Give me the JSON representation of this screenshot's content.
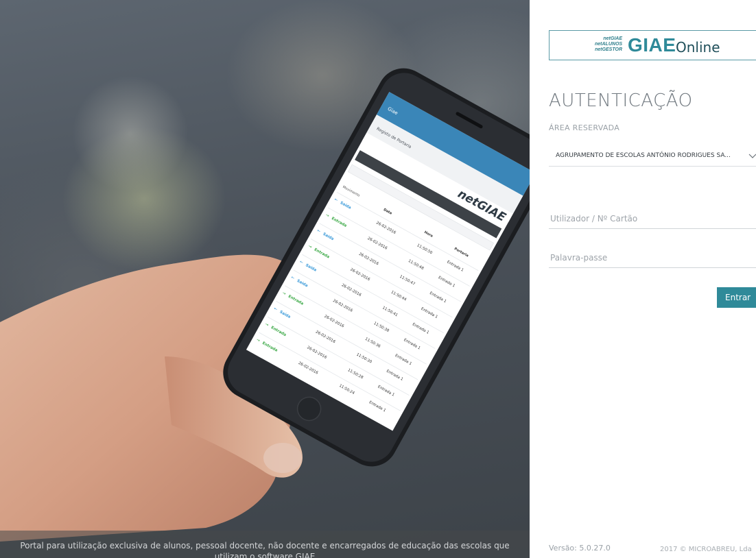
{
  "hero": {
    "caption": "Portal para utilização exclusiva de alunos, pessoal docente, não docente e encarregados de educação das escolas que utilizam o software GIAE",
    "phone": {
      "app_header": "Giae",
      "page_title": "Registo de Portaria",
      "brand": "netGIAE",
      "table_headers": [
        "Movimento",
        "Data",
        "Hora",
        "Portaria"
      ],
      "rows": [
        {
          "movimento": "Saída",
          "data": "26-02-2016",
          "hora": "11:50:50",
          "portaria": "Entrada 1"
        },
        {
          "movimento": "Entrada",
          "data": "26-02-2016",
          "hora": "11:50:48",
          "portaria": "Entrada 1"
        },
        {
          "movimento": "Saída",
          "data": "26-02-2016",
          "hora": "11:50:47",
          "portaria": "Entrada 1"
        },
        {
          "movimento": "Entrada",
          "data": "26-02-2016",
          "hora": "11:50:44",
          "portaria": "Entrada 1"
        },
        {
          "movimento": "Saída",
          "data": "26-02-2016",
          "hora": "11:50:41",
          "portaria": "Entrada 1"
        },
        {
          "movimento": "Saída",
          "data": "26-02-2016",
          "hora": "11:50:38",
          "portaria": "Entrada 1"
        },
        {
          "movimento": "Entrada",
          "data": "26-02-2016",
          "hora": "11:50:36",
          "portaria": "Entrada 1"
        },
        {
          "movimento": "Saída",
          "data": "26-02-2016",
          "hora": "11:50:30",
          "portaria": "Entrada 1"
        },
        {
          "movimento": "Entrada",
          "data": "26-02-2016",
          "hora": "11:50:28",
          "portaria": "Entrada 1"
        },
        {
          "movimento": "Entrada",
          "data": "26-02-2016",
          "hora": "11:50:24",
          "portaria": "Entrada 1"
        }
      ]
    }
  },
  "logo": {
    "mini_lines": [
      "netGIAE",
      "netALUNOS",
      "netGESTOR"
    ],
    "main": "GIAE",
    "suffix": "Online"
  },
  "auth": {
    "title": "AUTENTICAÇÃO",
    "area_label": "ÁREA RESERVADA",
    "school_selected": "AGRUPAMENTO DE ESCOLAS ANTÓNIO RODRIGUES SA...",
    "user_placeholder": "Utilizador / Nº Cartão",
    "password_placeholder": "Palavra-passe",
    "submit_label": "Entrar"
  },
  "footer": {
    "version": "Versão: 5.0.27.0",
    "copyright": "2017 © MICROABREU, Lda"
  },
  "colors": {
    "accent": "#2f8a99",
    "saida": "#3a9ad9",
    "entrada": "#3aa845",
    "alert": "#e03b3b"
  }
}
